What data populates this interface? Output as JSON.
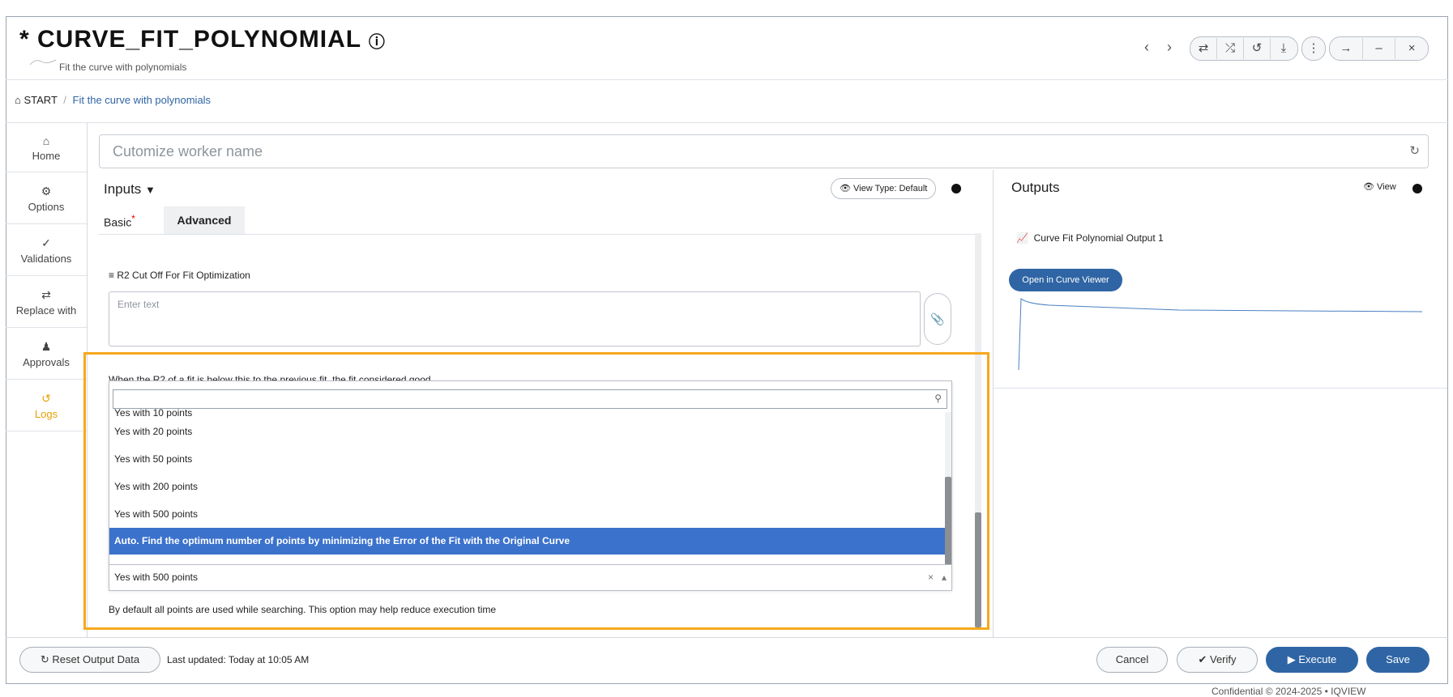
{
  "header": {
    "title": "* CURVE_FIT_POLYNOMIAL",
    "subtitle": "Fit the curve with polynomials",
    "toolbar_icons": [
      "prev-arrow",
      "next-arrow",
      "swap-icon",
      "shuffle-icon",
      "undo-icon",
      "download-icon",
      "more-icon",
      "arrow-right-icon",
      "minimize-icon",
      "close-icon"
    ]
  },
  "breadcrumb": {
    "home": "START",
    "separator": "/",
    "current": "Fit the curve with polynomials"
  },
  "sidebar": {
    "items": [
      {
        "label": "Home",
        "icon": "home-icon"
      },
      {
        "label": "Options",
        "icon": "gear-icon"
      },
      {
        "label": "Validations",
        "icon": "check-icon"
      },
      {
        "label": "Replace with",
        "icon": "swap-icon"
      },
      {
        "label": "Approvals",
        "icon": "user-check-icon"
      },
      {
        "label": "Logs",
        "icon": "history-icon",
        "color": "#e8a000"
      }
    ]
  },
  "worker": {
    "placeholder": "Cutomize worker name"
  },
  "inputs": {
    "title": "Inputs",
    "view_type": "View Type: Default",
    "tabs": [
      {
        "label": "Basic",
        "required": "*"
      },
      {
        "label": "Advanced"
      }
    ],
    "field_label": "R2 Cut Off For Fit Optimization",
    "field_placeholder": "Enter text",
    "field_description": "When the R2 of a fit is below this to the previous fit, the fit considered good"
  },
  "dropdown": {
    "options": [
      "Yes with 10 points",
      "Yes with 20 points",
      "Yes with 50 points",
      "Yes with 200 points",
      "Yes with 500 points",
      "Auto. Find the optimum number of points by minimizing the Error of the Fit with the Original Curve"
    ],
    "selected_index": 5,
    "current_value": "Yes with 500 points",
    "clear": "×",
    "caret": "▴",
    "help_text": "By default all points are used while searching. This option may help reduce execution time"
  },
  "outputs": {
    "title": "Outputs",
    "view": "View",
    "item": "Curve Fit Polynomial Output 1",
    "open_button": "Open in Curve Viewer"
  },
  "footer": {
    "reset": "Reset Output Data",
    "last_updated": "Last updated: Today at 10:05 AM",
    "cancel": "Cancel",
    "verify": "Verify",
    "execute": "Execute",
    "save": "Save"
  },
  "colors": {
    "highlight": "#f5a81d",
    "primary": "#2f65a4",
    "selected_option": "#3b72cc"
  },
  "footnote": "Confidential © 2024-2025 • IQVIEW"
}
